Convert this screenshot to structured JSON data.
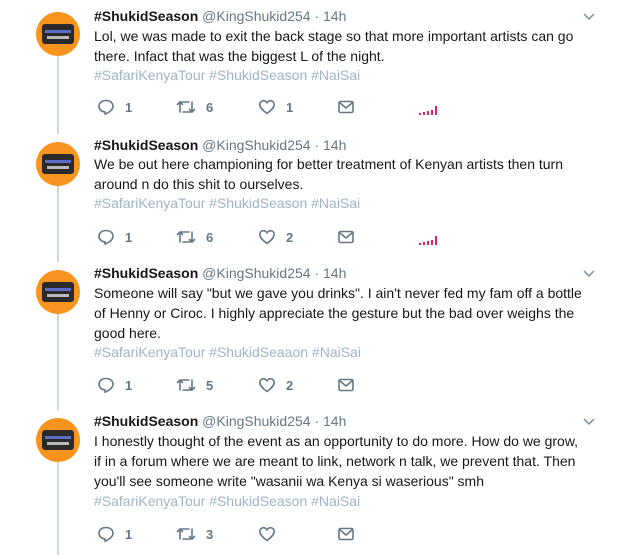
{
  "tweets": [
    {
      "name": "#ShukidSeason",
      "handle": "@KingShukid254",
      "separator": "·",
      "time": "14h",
      "lines": [
        "Lol, we was made to exit the back stage so that more important artists can go",
        "there. Infact that was the biggest L of the night."
      ],
      "tags": "#SafariKenyaTour #ShukidSeason #NaiSai",
      "replies": "1",
      "retweets": "6",
      "likes": "1"
    },
    {
      "name": "#ShukidSeason",
      "handle": "@KingShukid254",
      "separator": "·",
      "time": "14h",
      "lines": [
        "We be out here championing for better treatment of Kenyan artists then turn",
        "around n do this shit to ourselves."
      ],
      "tags": "#SafariKenyaTour #ShukidSeason #NaiSai",
      "replies": "1",
      "retweets": "6",
      "likes": "2"
    },
    {
      "name": "#ShukidSeason",
      "handle": "@KingShukid254",
      "separator": "·",
      "time": "14h",
      "lines": [
        "Someone will say \"but we gave you drinks\". I ain't never fed my fam off a bottle",
        "of Henny or Ciroc. I highly appreciate the gesture but the bad over weighs the",
        "good here."
      ],
      "tags": "#SafariKenyaTour #ShukidSeaaon #NaiSai",
      "replies": "1",
      "retweets": "5",
      "likes": "2"
    },
    {
      "name": "#ShukidSeason",
      "handle": "@KingShukid254",
      "separator": "·",
      "time": "14h",
      "lines": [
        "I honestly thought of the event as an opportunity to do more. How do we grow,",
        "if in a forum where we are meant to link, network n talk, we prevent that. Then",
        "you'll see someone write \"wasanii wa Kenya si waserious\" smh"
      ],
      "tags": "#SafariKenyaTour #ShukidSeason #NaiSai",
      "replies": "1",
      "retweets": "3",
      "likes": ""
    }
  ],
  "icons": {
    "reply": "reply-icon",
    "retweet": "retweet-icon",
    "like": "heart-icon",
    "dm": "envelope-icon",
    "analytics": "analytics-icon",
    "caret": "chevron-down-icon"
  },
  "colors": {
    "text": "#14171a",
    "secondary": "#657786",
    "hashtag": "#9fb4c7",
    "thread_line": "#ccd6dd",
    "analytics": "#e0245e",
    "avatar": "#f7941d"
  }
}
